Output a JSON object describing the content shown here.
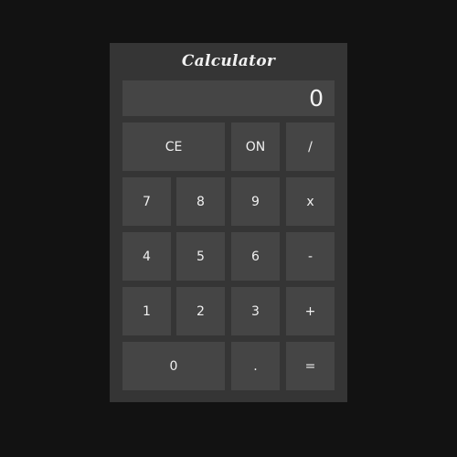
{
  "app": {
    "title": "Calculator",
    "display_value": "0"
  },
  "colors": {
    "page_background": "#121212",
    "panel_background": "#353535",
    "button_background": "#454545",
    "text": "#f0f0f0"
  },
  "keys": {
    "clear_entry": "CE",
    "on": "ON",
    "divide": "/",
    "seven": "7",
    "eight": "8",
    "nine": "9",
    "multiply": "x",
    "four": "4",
    "five": "5",
    "six": "6",
    "subtract": "-",
    "one": "1",
    "two": "2",
    "three": "3",
    "add": "+",
    "zero": "0",
    "decimal": ".",
    "equals": "="
  }
}
